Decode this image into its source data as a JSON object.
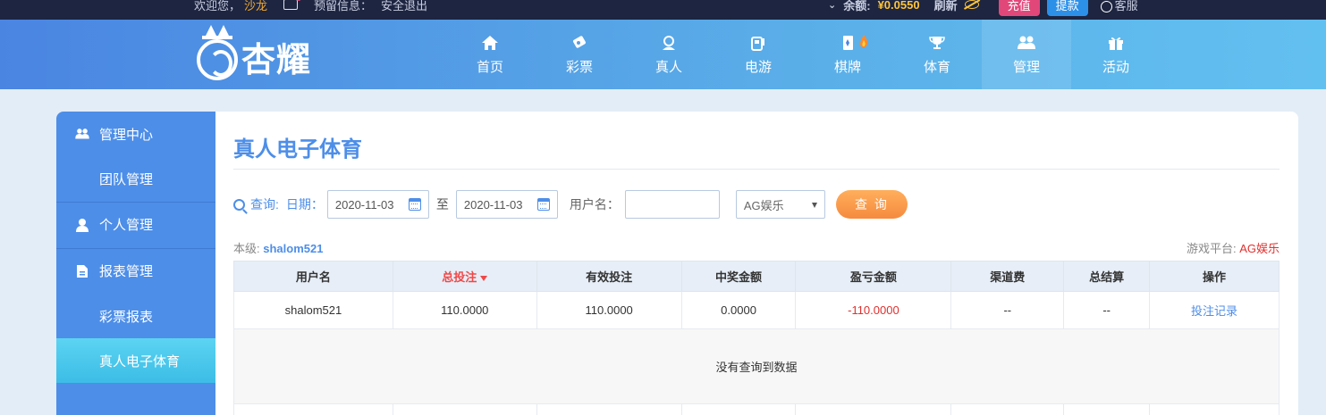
{
  "topbar": {
    "welcome": "欢迎您，",
    "username": "沙龙",
    "reserve_label": "预留信息：",
    "logout": "安全退出",
    "balance_label": "余额:",
    "balance": "¥0.0550",
    "refresh": "刷新",
    "recharge": "充值",
    "withdraw": "提款",
    "service": "客服"
  },
  "logo": {
    "text": "杏耀"
  },
  "nav": {
    "items": [
      {
        "label": "首页",
        "icon": "home-icon"
      },
      {
        "label": "彩票",
        "icon": "lottery-icon"
      },
      {
        "label": "真人",
        "icon": "live-dealer-icon"
      },
      {
        "label": "电游",
        "icon": "slot-machine-icon"
      },
      {
        "label": "棋牌",
        "icon": "card-game-icon"
      },
      {
        "label": "体育",
        "icon": "trophy-icon"
      },
      {
        "label": "管理",
        "icon": "users-icon"
      },
      {
        "label": "活动",
        "icon": "gift-icon"
      }
    ],
    "active": "管理"
  },
  "sidebar": {
    "items": [
      {
        "label": "管理中心",
        "type": "head",
        "icon": "users-icon"
      },
      {
        "label": "团队管理",
        "type": "sub"
      },
      {
        "label": "个人管理",
        "type": "head",
        "icon": "user-icon"
      },
      {
        "label": "报表管理",
        "type": "head",
        "icon": "report-icon"
      },
      {
        "label": "彩票报表",
        "type": "sub"
      },
      {
        "label": "真人电子体育",
        "type": "sub",
        "active": true
      }
    ]
  },
  "main": {
    "title": "真人电子体育",
    "query": {
      "label": "查询:",
      "date_label": "日期：",
      "date_from": "2020-11-03",
      "to_label": "至",
      "date_to": "2020-11-03",
      "username_label": "用户名：",
      "username_value": "",
      "platform_select": "AG娱乐",
      "button": "查 询"
    },
    "level_label": "本级:",
    "level_value": "shalom521",
    "platform_label": "游戏平台:",
    "platform_value": "AG娱乐",
    "table": {
      "columns": [
        "用户名",
        "总投注",
        "有效投注",
        "中奖金额",
        "盈亏金额",
        "渠道费",
        "总结算",
        "操作"
      ],
      "sorted_column": "总投注",
      "rows": [
        [
          "shalom521",
          "110.0000",
          "110.0000",
          "0.0000",
          "-110.0000",
          "--",
          "--",
          "投注记录"
        ]
      ],
      "empty_message": "没有查询到数据"
    }
  },
  "colors": {
    "accent": "#4d8ee8",
    "topbar_bg": "#1d2540",
    "negative": "#e0302e",
    "query_button": "#f58a3e"
  }
}
